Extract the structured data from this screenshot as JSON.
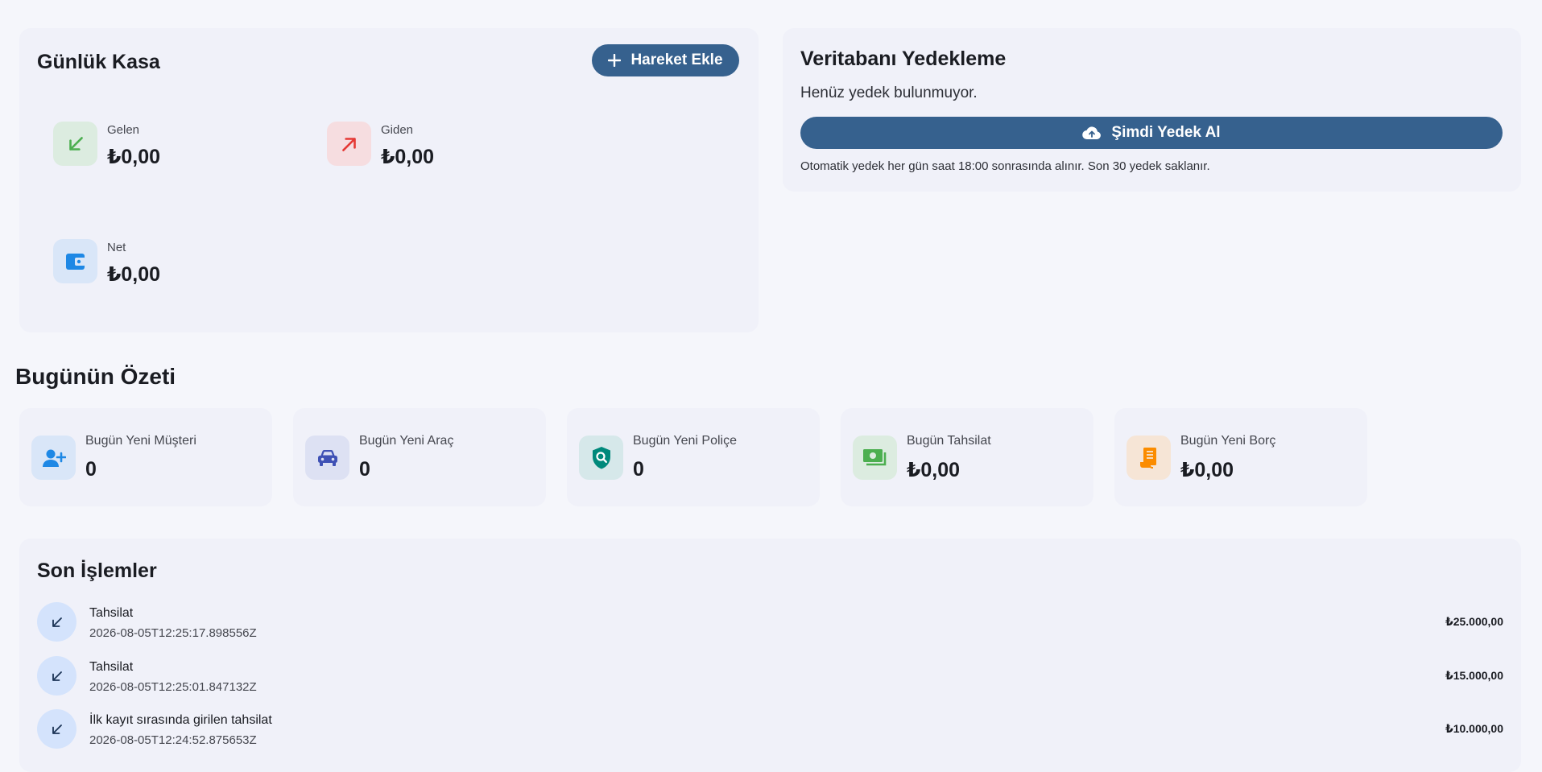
{
  "cash": {
    "title": "Günlük Kasa",
    "add_button": "Hareket Ekle",
    "income_label": "Gelen",
    "income_value": "₺0,00",
    "expense_label": "Giden",
    "expense_value": "₺0,00",
    "net_label": "Net",
    "net_value": "₺0,00"
  },
  "backup": {
    "title": "Veritabanı Yedekleme",
    "empty_text": "Henüz yedek bulunmuyor.",
    "button": "Şimdi Yedek Al",
    "note": "Otomatik yedek her gün saat 18:00 sonrasında alınır. Son 30 yedek saklanır."
  },
  "summary": {
    "title": "Bugünün Özeti",
    "cards": [
      {
        "label": "Bugün Yeni Müşteri",
        "value": "0",
        "icon": "person-add-icon"
      },
      {
        "label": "Bugün Yeni Araç",
        "value": "0",
        "icon": "car-icon"
      },
      {
        "label": "Bugün Yeni Poliçe",
        "value": "0",
        "icon": "policy-shield-icon"
      },
      {
        "label": "Bugün Tahsilat",
        "value": "₺0,00",
        "icon": "cash-icon"
      },
      {
        "label": "Bugün Yeni Borç",
        "value": "₺0,00",
        "icon": "receipt-icon"
      }
    ]
  },
  "recent": {
    "title": "Son İşlemler",
    "items": [
      {
        "title": "Tahsilat",
        "time": "2026-08-05T12:25:17.898556Z",
        "amount": "₺25.000,00"
      },
      {
        "title": "Tahsilat",
        "time": "2026-08-05T12:25:01.847132Z",
        "amount": "₺15.000,00"
      },
      {
        "title": "İlk kayıt sırasında girilen tahsilat",
        "time": "2026-08-05T12:24:52.875653Z",
        "amount": "₺10.000,00"
      }
    ]
  },
  "colors": {
    "primary": "#36618e",
    "income": "#4caf50",
    "expense": "#e53935",
    "net": "#1e88e5",
    "card_bg": "#f0f1f9",
    "page_bg": "#f5f6fb"
  }
}
